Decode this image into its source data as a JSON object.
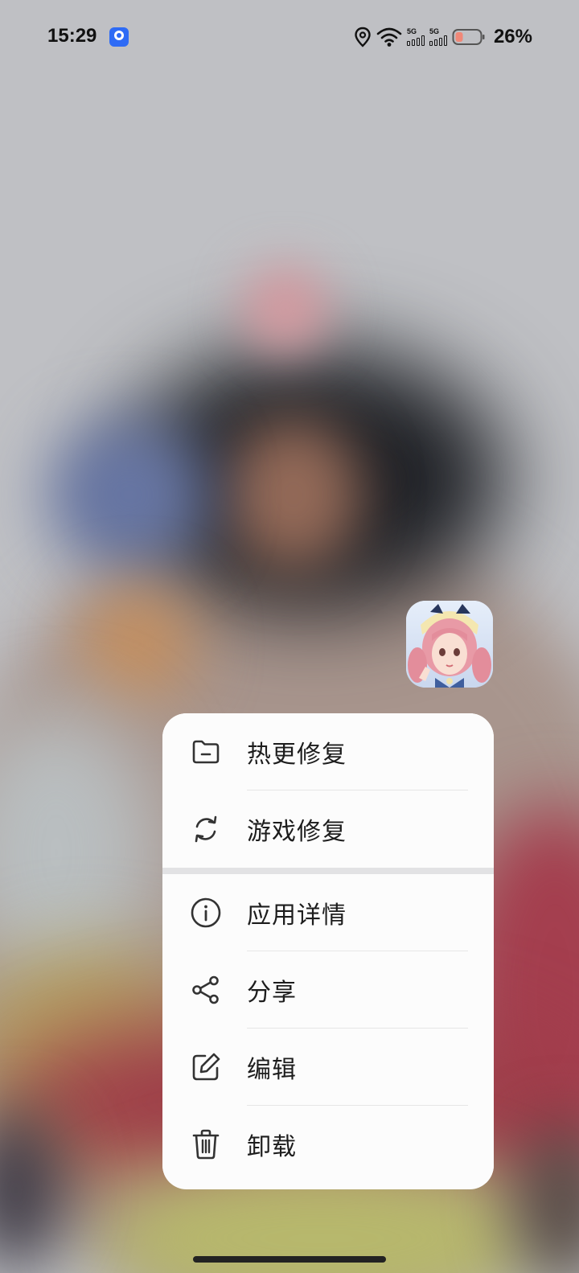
{
  "status_bar": {
    "time": "15:29",
    "notification_icon": "app-store-icon",
    "signal_1_label": "5G",
    "signal_2_label": "5G",
    "battery_percent": "26%",
    "battery_level": 0.26
  },
  "app_icon": {
    "icon": "game-character-app-icon"
  },
  "menu": {
    "group1": [
      {
        "label": "热更修复",
        "icon": "folder-icon"
      },
      {
        "label": "游戏修复",
        "icon": "refresh-icon"
      }
    ],
    "group2": [
      {
        "label": "应用详情",
        "icon": "info-icon"
      },
      {
        "label": "分享",
        "icon": "share-icon"
      },
      {
        "label": "编辑",
        "icon": "edit-icon"
      },
      {
        "label": "卸载",
        "icon": "trash-icon"
      }
    ]
  },
  "colors": {
    "menu_background": "#fcfcfc",
    "icon_color": "#333333",
    "text_color": "#1d1d1d"
  }
}
